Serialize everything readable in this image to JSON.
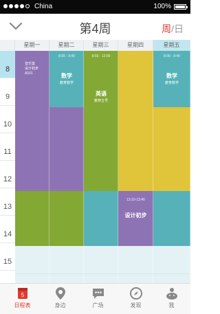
{
  "status_bar": {
    "carrier": "China",
    "battery": "100%"
  },
  "header": {
    "title": "第4周",
    "view_week": "周",
    "view_sep": "/",
    "view_day": "日"
  },
  "calendar": {
    "days": [
      "星期一",
      "星期二",
      "星期三",
      "星期四",
      "星期五"
    ],
    "hours": [
      "8",
      "9",
      "10",
      "11",
      "12",
      "13",
      "14",
      "15"
    ],
    "current_hour": "8",
    "events": {
      "mon": {
        "title": "音乐鉴",
        "lines": [
          "设计初步",
          "A101"
        ]
      },
      "tue": {
        "time": "8:55 - 9:40",
        "title": "数学",
        "place": "教育数学"
      },
      "wed": {
        "time": "8:55 - 12:00",
        "title": "英语",
        "place": "教育五号"
      },
      "thu": {
        "time": "13:10-13:40",
        "title": "设计初步"
      },
      "fri": {
        "time": "8:00 - 9:40",
        "title": "数学",
        "place": "教育数学"
      }
    }
  },
  "tabs": [
    "日程表",
    "身边",
    "广场",
    "发现",
    "我"
  ],
  "tab_badge": "5",
  "colors": {
    "purple": "#8e73b4",
    "teal": "#56b2b8",
    "green": "#84a834",
    "yellow": "#e0c43a",
    "light": "#e4f2f6",
    "accent": "#e03a2e"
  }
}
